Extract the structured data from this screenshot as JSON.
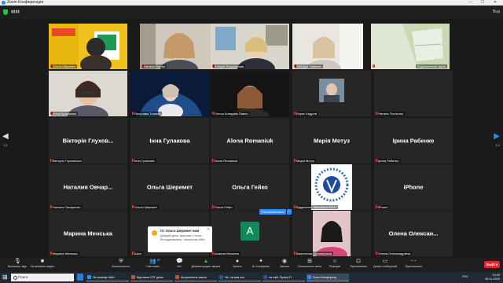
{
  "window": {
    "title": "Zoom Конференция",
    "minimize": "—",
    "maximize": "☐",
    "close": "✕"
  },
  "topbar": {
    "signal": "▮▮▮▮",
    "view_label": "Вид"
  },
  "tiles": [
    {
      "name": "Ольга Шеремет",
      "video": "man-poster"
    },
    {
      "name": "Наталія Пугіна",
      "video": "woman-wall"
    },
    {
      "name": "Клиция Евдокимова",
      "video": "woman-office"
    },
    {
      "name": "Viktoriya Zaitseva",
      "video": "woman-light"
    },
    {
      "name": "Людмила Сорока",
      "video": "woman-room"
    },
    {
      "name": "Подключение звука",
      "video": "window-wall"
    },
    {
      "name": "Алла Кузьменко",
      "video": "woman-glasses"
    },
    {
      "name": "Ярослава Тешель",
      "video": "woman-earth"
    },
    {
      "name": "Олеся Шевцова Павло",
      "video": "woman-dark"
    },
    {
      "name": "Борис Кадров",
      "video": "man-photo"
    },
    {
      "name": "Наталя Тесленко",
      "video": ""
    },
    {
      "name": "Вікторія Глуховська",
      "big": "Вікторія Глухов..."
    },
    {
      "name": "Інна Гулакова",
      "big": "Інна Гулакова"
    },
    {
      "name": "Alona Romaniuk",
      "big": "Alona Romaniuk"
    },
    {
      "name": "Марія Мотуз",
      "big": "Марія Мотуз"
    },
    {
      "name": "Ірина Рабенко",
      "big": "Ірина Рабенко"
    },
    {
      "name": "Наталія Овчаренко",
      "big": "Наталия Овчар..."
    },
    {
      "name": "Ольга Шеремет",
      "big": "Ольга Шеремет"
    },
    {
      "name": "Ольга Гейко",
      "big": "Ольга Гейко"
    },
    {
      "name": "Відділення Черкаська МАН",
      "video": "logo"
    },
    {
      "name": "iPhone",
      "big": "iPhone"
    },
    {
      "name": "Марина Менська",
      "big": "Марина Менська"
    },
    {
      "name": "Шкаг",
      "big": ""
    },
    {
      "name": "Анжела Мосичко",
      "big": "A",
      "avatar": true
    },
    {
      "name": "Валентина Суховерська",
      "video": "woman-pink"
    },
    {
      "name": "Олена Олександрівна",
      "big": "Олена Олексан..."
    },
    {
      "name": "",
      "big": ""
    }
  ],
  "page_indicator": {
    "left": "1/4",
    "right": "1/4"
  },
  "notification": {
    "title": "От Ольга Шеремет вам",
    "body": "Добрий день. Шеремет Ольга Володимирівна, Черкаська МАН",
    "close": "✕"
  },
  "rename_label": "Переименовать",
  "toolbar": {
    "items": [
      {
        "label": "Включить звук",
        "icon": "mic-icon"
      },
      {
        "label": "Остановить видео",
        "icon": "video-icon"
      },
      {
        "label": "Безопасность",
        "icon": "shield-icon"
      },
      {
        "label": "Участники",
        "icon": "participants-icon",
        "count": "27"
      },
      {
        "label": "Чат",
        "icon": "chat-icon"
      },
      {
        "label": "Демонстрация экрана",
        "icon": "share-icon"
      },
      {
        "label": "Запись",
        "icon": "record-icon"
      },
      {
        "label": "Ai Companion",
        "icon": "sparkle-icon"
      },
      {
        "label": "Запись",
        "icon": "record2-icon"
      },
      {
        "label": "Сессионные залы",
        "icon": "rooms-icon"
      },
      {
        "label": "Реакции",
        "icon": "reaction-icon"
      },
      {
        "label": "Приложения",
        "icon": "apps-icon"
      },
      {
        "label": "Доска сообщений",
        "icon": "whiteboard-icon"
      },
      {
        "label": "Приложения",
        "icon": "more-icon"
      }
    ],
    "end_label": "Выйти"
  },
  "taskbar": {
    "search_placeholder": "Поиск",
    "tasks": [
      {
        "label": "Як семінар МАН"
      },
      {
        "label": "Картинка СПГ демо"
      },
      {
        "label": "Актуальність викон"
      },
      {
        "label": "Як і за ким пок"
      },
      {
        "label": "на сайт Пуліна П"
      },
      {
        "label": "Zoom Конференц"
      }
    ],
    "time": "10:02",
    "date": "06.11.2023",
    "lang": "РУС"
  }
}
